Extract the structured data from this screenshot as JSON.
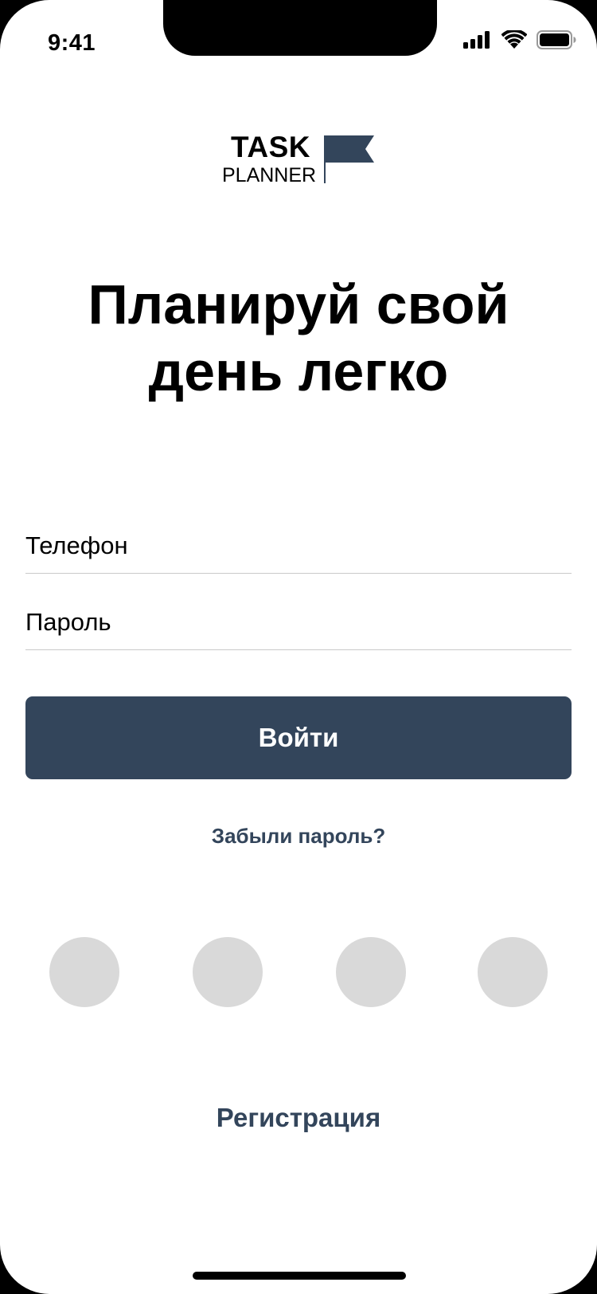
{
  "status_bar": {
    "time": "9:41",
    "icons": [
      "cellular-signal-icon",
      "wifi-icon",
      "battery-icon"
    ]
  },
  "logo": {
    "line1": "TASK",
    "line2": "PLANNER",
    "icon": "flag-icon",
    "flag_color": "#33455b"
  },
  "headline": {
    "line1": "Планируй свой",
    "line2": "день легко"
  },
  "form": {
    "phone_label": "Телефон",
    "password_label": "Пароль",
    "login_label": "Войти"
  },
  "links": {
    "forgot_password": "Забыли пароль?",
    "register": "Регистрация"
  },
  "social_buttons": [
    "",
    "",
    "",
    ""
  ],
  "colors": {
    "accent": "#33455b",
    "placeholder_circle": "#d9d9d9",
    "divider": "#c9c9c9",
    "background": "#ffffff"
  }
}
